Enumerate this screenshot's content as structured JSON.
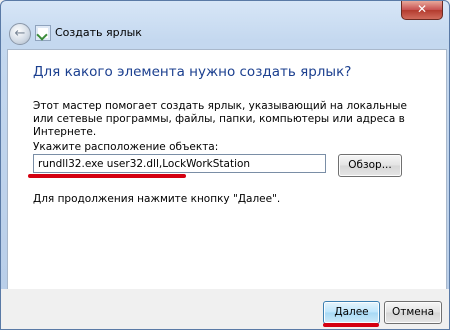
{
  "window": {
    "close_label": "✕",
    "title": "Создать ярлык",
    "back_icon": "back-arrow-icon"
  },
  "main": {
    "heading": "Для какого элемента нужно создать ярлык?",
    "description": "Этот мастер помогает создать ярлык, указывающий на локальные или сетевые программы, файлы, папки, компьютеры или адреса в Интернете.",
    "location_label": "Укажите расположение объекта:",
    "location_value": "rundll32.exe user32.dll,LockWorkStation",
    "browse_label": "Обзор...",
    "hint": "Для продолжения нажмите кнопку \"Далее\"."
  },
  "footer": {
    "next_label": "Далее",
    "cancel_label": "Отмена"
  },
  "colors": {
    "heading": "#1b3f8f",
    "highlight_underline": "#d40010"
  }
}
